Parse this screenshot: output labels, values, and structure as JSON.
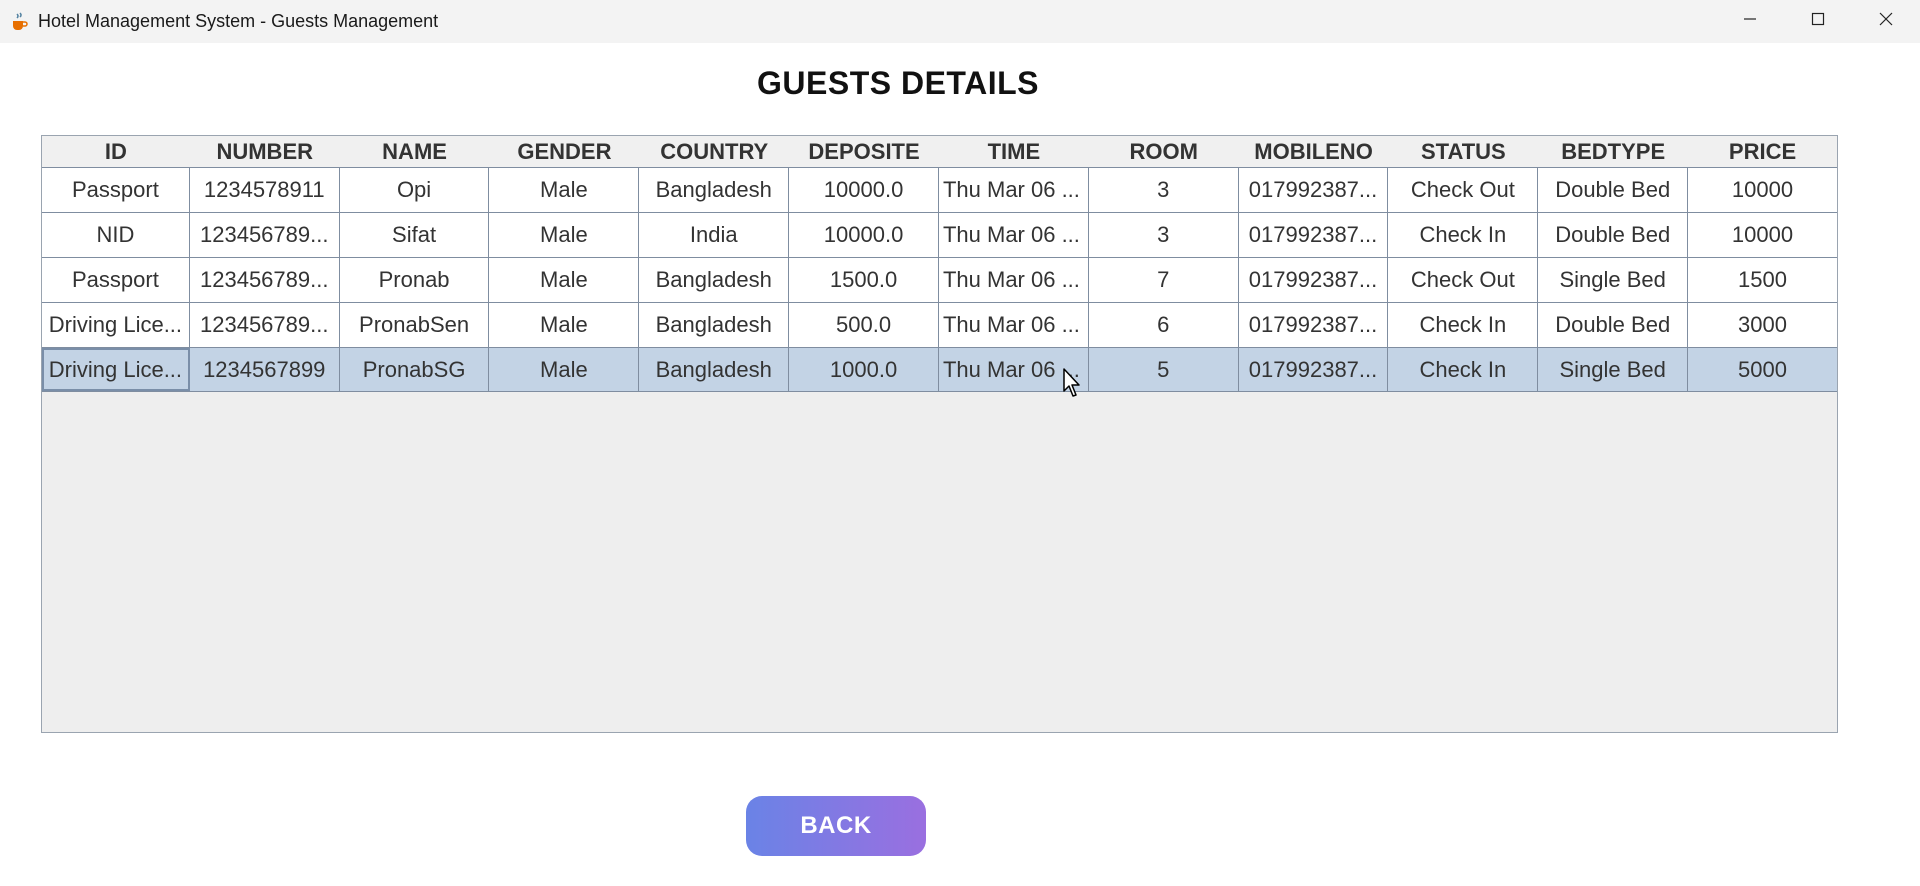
{
  "window": {
    "title": "Hotel Management System - Guests Management",
    "icon": "java-cup-icon",
    "controls": [
      "minimize-icon",
      "maximize-icon",
      "close-icon"
    ]
  },
  "page": {
    "title": "GUESTS DETAILS"
  },
  "table": {
    "columns": [
      "ID",
      "NUMBER",
      "NAME",
      "GENDER",
      "COUNTRY",
      "DEPOSITE",
      "TIME",
      "ROOM",
      "MOBILENO",
      "STATUS",
      "BEDTYPE",
      "PRICE"
    ],
    "rows": [
      [
        "Passport",
        "1234578911",
        "Opi",
        "Male",
        "Bangladesh",
        "10000.0",
        "Thu Mar 06 ...",
        "3",
        "017992387...",
        "Check Out",
        "Double Bed",
        "10000"
      ],
      [
        "NID",
        "123456789...",
        "Sifat",
        "Male",
        "India",
        "10000.0",
        "Thu Mar 06 ...",
        "3",
        "017992387...",
        "Check In",
        "Double Bed",
        "10000"
      ],
      [
        "Passport",
        "123456789...",
        "Pronab",
        "Male",
        "Bangladesh",
        "1500.0",
        "Thu Mar 06 ...",
        "7",
        "017992387...",
        "Check Out",
        "Single Bed",
        "1500"
      ],
      [
        "Driving Lice...",
        "123456789...",
        "PronabSen",
        "Male",
        "Bangladesh",
        "500.0",
        "Thu Mar 06 ...",
        "6",
        "017992387...",
        "Check In",
        "Double Bed",
        "3000"
      ],
      [
        "Driving Lice...",
        "1234567899",
        "PronabSG",
        "Male",
        "Bangladesh",
        "1000.0",
        "Thu Mar 06 ...",
        "5",
        "017992387...",
        "Check In",
        "Single Bed",
        "5000"
      ]
    ],
    "selected_row": 4
  },
  "buttons": {
    "back_label": "BACK"
  },
  "colors": {
    "selection": "#c3d3e5",
    "button_gradient_start": "#6a83e6",
    "button_gradient_end": "#9a6fe0"
  }
}
